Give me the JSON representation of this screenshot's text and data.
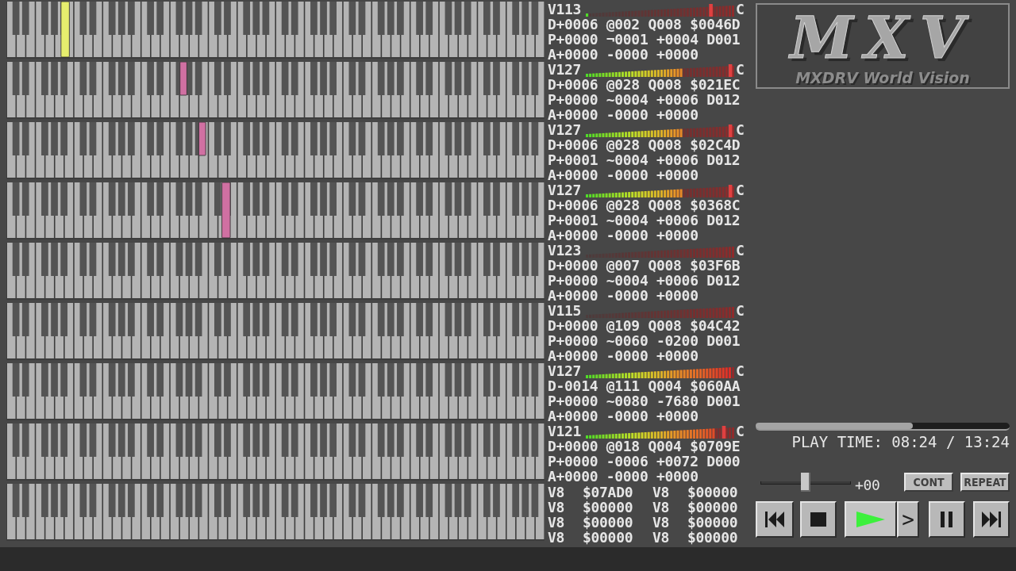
{
  "channels": [
    {
      "pressed_key": {
        "level": 0.109,
        "black": false
      },
      "color": "#e6ee6e",
      "meter": {
        "level": 0.02
      },
      "peak": {
        "level": 0.84
      },
      "volume": "V113",
      "clip": "C",
      "lines": [
        "D+0006 @002 Q008 $0046D",
        "P+0000 ¬0001 +0004 D001",
        "A+0000 -0000 +0000"
      ]
    },
    {
      "pressed_key": {
        "level": 0.329,
        "black": true
      },
      "color": "#d070a2",
      "meter": {
        "level": 0.66
      },
      "peak": {
        "level": 0.98
      },
      "volume": "V127",
      "clip": "C",
      "lines": [
        "D+0006 @028 Q008 $021EC",
        "P+0000 ~0004 +0006 D012",
        "A+0000 -0000 +0000"
      ]
    },
    {
      "pressed_key": {
        "level": 0.364,
        "black": true
      },
      "color": "#d070a2",
      "meter": {
        "level": 0.66
      },
      "peak": {
        "level": 0.98
      },
      "volume": "V127",
      "clip": "C",
      "lines": [
        "D+0006 @028 Q008 $02C4D",
        "P+0001 ~0004 +0006 D012",
        "A+0000 -0000 +0000"
      ]
    },
    {
      "pressed_key": {
        "level": 0.408,
        "black": false
      },
      "color": "#d070a2",
      "meter": {
        "level": 0.66
      },
      "peak": {
        "level": 0.98
      },
      "volume": "V127",
      "clip": "C",
      "lines": [
        "D+0006 @028 Q008 $0368C",
        "P+0001 ~0004 +0006 D012",
        "A+0000 -0000 +0000"
      ]
    },
    {
      "volume": "V123",
      "clip": "C",
      "lines": [
        "D+0000 @007 Q008 $03F6B",
        "P+0000 ~0004 +0006 D012",
        "A+0000 -0000 +0000"
      ]
    },
    {
      "volume": "V115",
      "clip": "C",
      "lines": [
        "D+0000 @109 Q008 $04C42",
        "P+0000 ~0060 -0200 D001",
        "A+0000 -0000 +0000"
      ]
    },
    {
      "meter": {
        "level": 0.97
      },
      "volume": "V127",
      "clip": "C",
      "lines": [
        "D-0014 @111 Q004 $060AA",
        "P+0000 ~0080 -7680 D001",
        "A+0000 -0000 +0000"
      ]
    },
    {
      "meter": {
        "level": 0.86
      },
      "peak": {
        "level": 0.94
      },
      "volume": "V121",
      "clip": "C",
      "lines": [
        "D+0000 @018 Q004 $0709E",
        "P+0000 -0006 +0072 D000",
        "A+0000 -0000 +0000"
      ]
    }
  ],
  "pcm_channels": [
    {
      "volume": "V8",
      "address": "$07AD0"
    },
    {
      "volume": "V8",
      "address": "$00000"
    },
    {
      "volume": "V8",
      "address": "$00000"
    },
    {
      "volume": "V8",
      "address": "$00000"
    },
    {
      "volume": "V8",
      "address": "$00000"
    },
    {
      "volume": "V8",
      "address": "$00000"
    },
    {
      "volume": "V8",
      "address": "$00000"
    },
    {
      "volume": "V8",
      "address": "$00000"
    }
  ],
  "logo": {
    "mark": "MXV",
    "subtitle": "MXDRV World Vision"
  },
  "progress": {
    "level": 0.62
  },
  "play_time": "PLAY TIME: 08:24 / 13:24",
  "pitch": {
    "level": 0.5,
    "reading": "+00"
  },
  "mode_buttons": [
    "CONT",
    "REPEAT"
  ],
  "transport": [
    {
      "kind": "prev",
      "selected": false
    },
    {
      "kind": "stop",
      "selected": false
    },
    {
      "kind": "play",
      "selected": true
    },
    {
      "kind": "step",
      "label": ">",
      "selected": false
    },
    {
      "kind": "pause",
      "selected": false
    },
    {
      "kind": "next",
      "selected": false
    }
  ]
}
